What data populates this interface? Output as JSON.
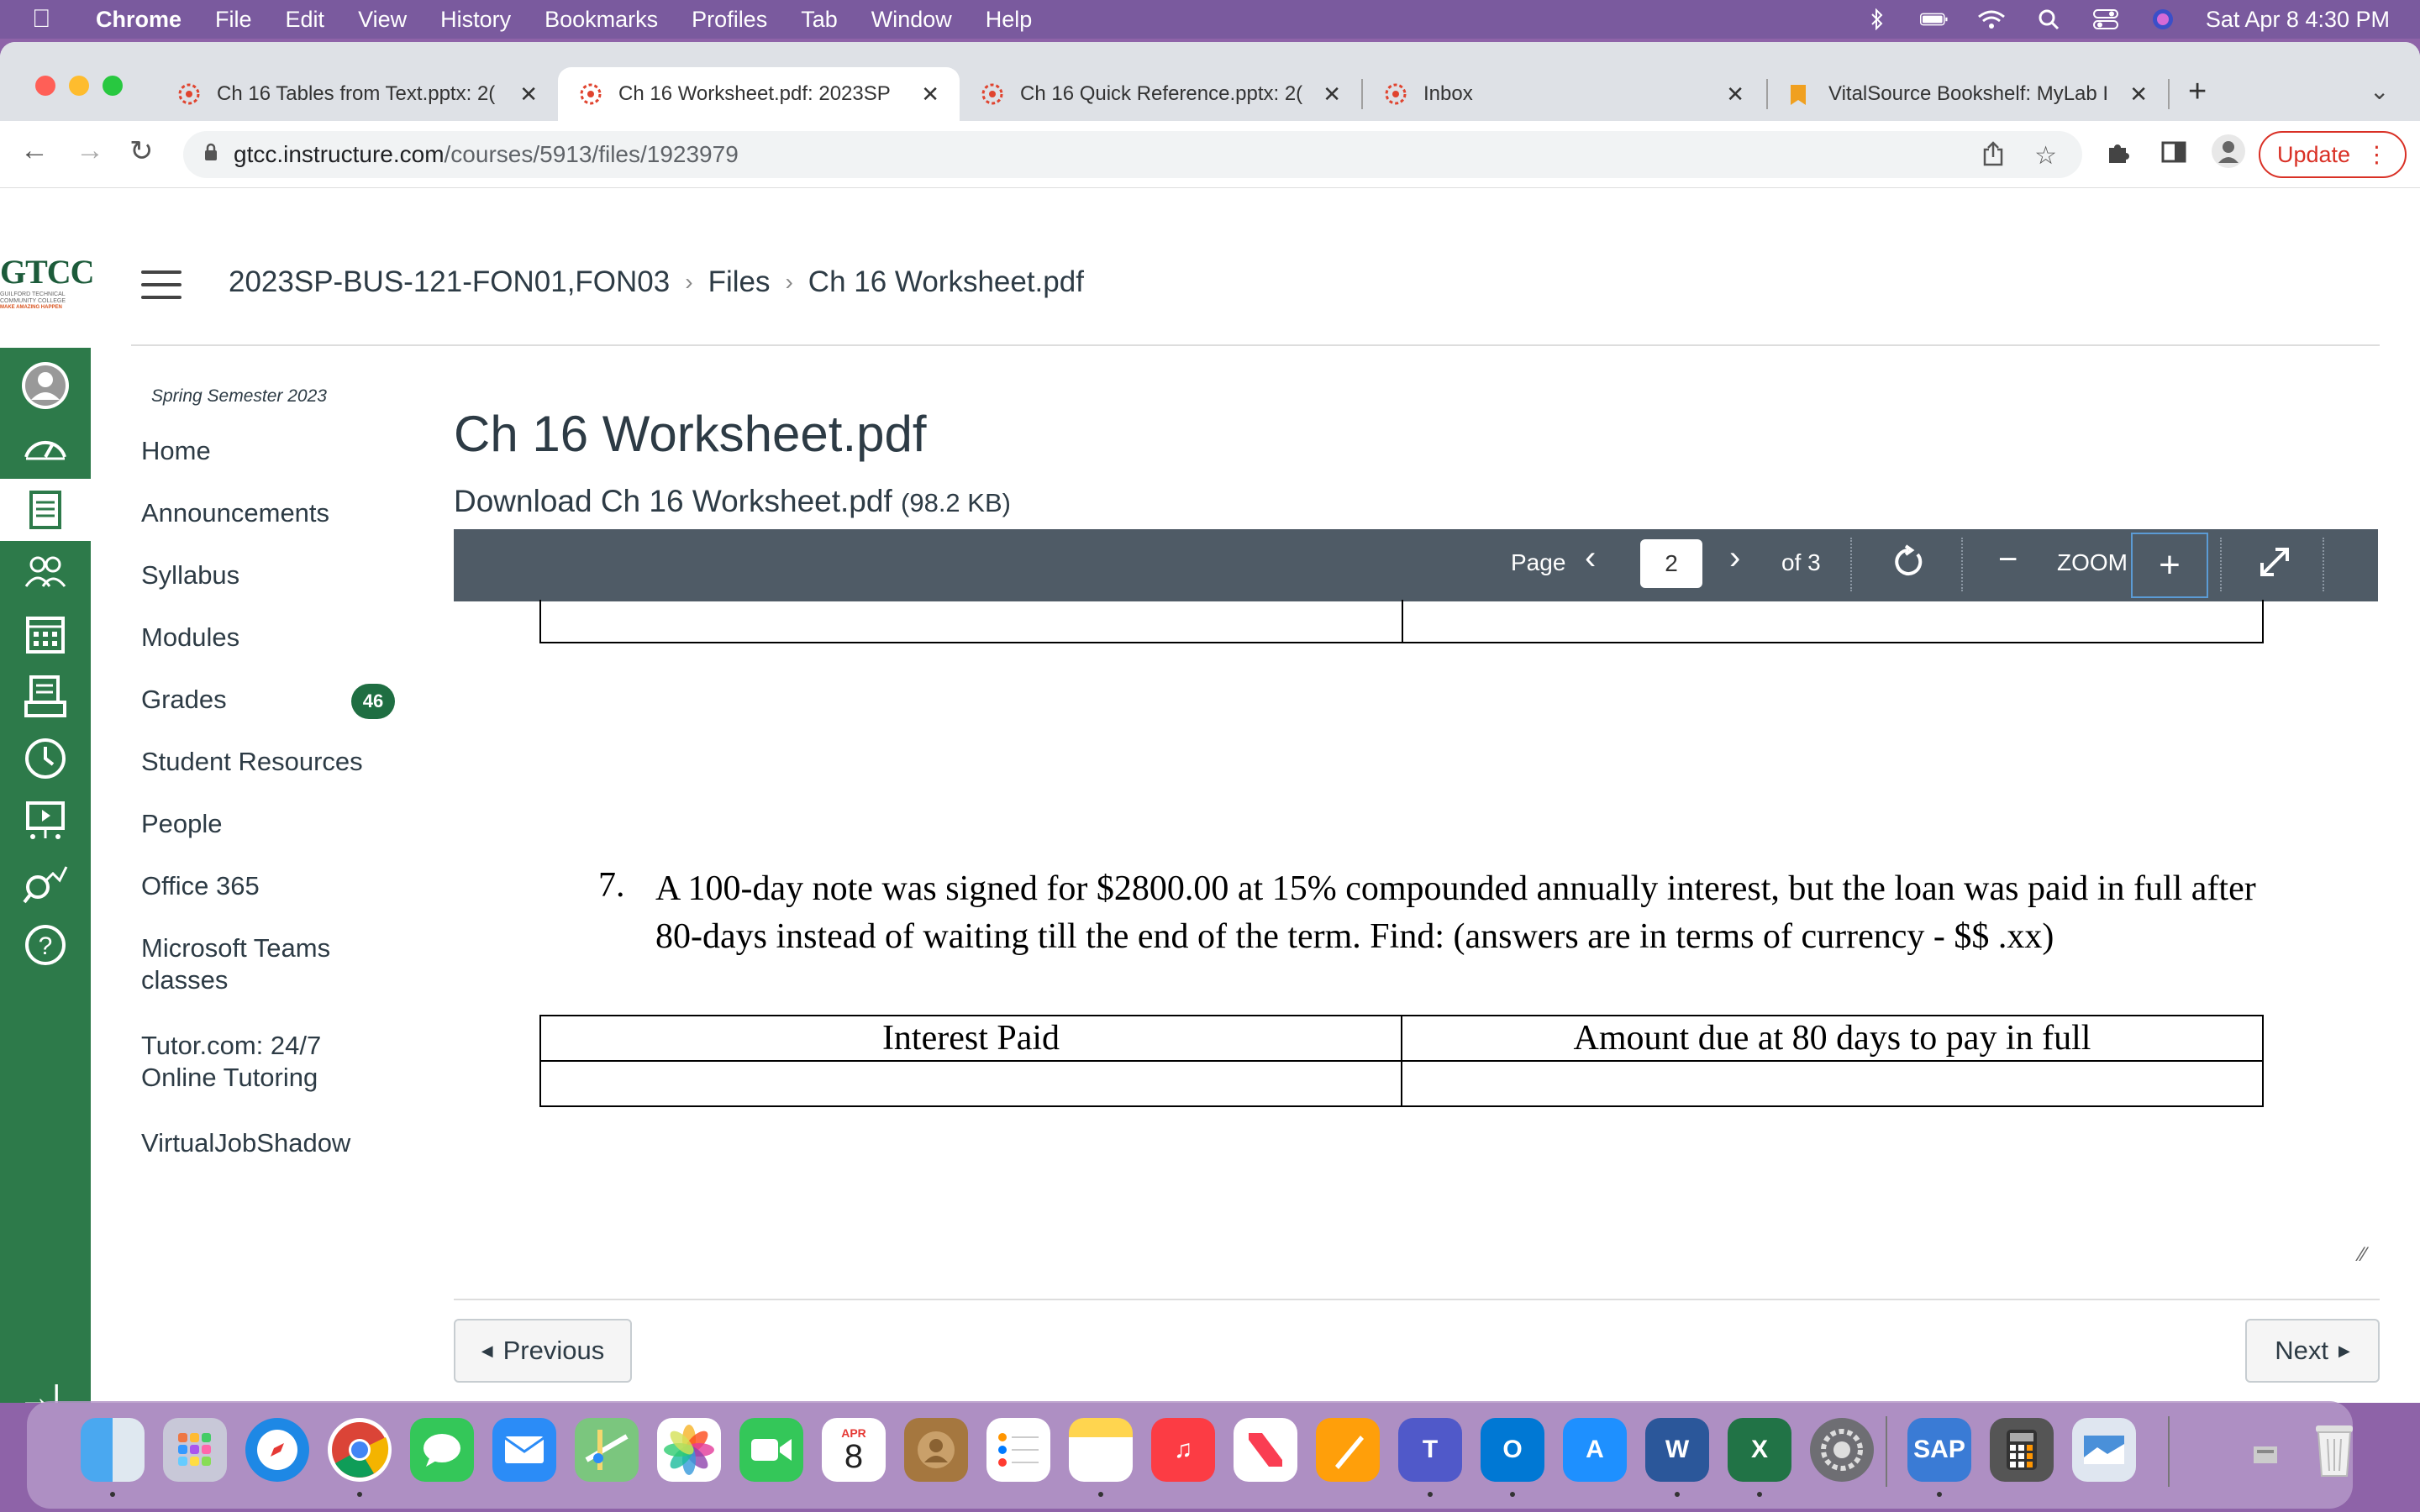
{
  "menubar": {
    "app": "Chrome",
    "items": [
      "File",
      "Edit",
      "View",
      "History",
      "Bookmarks",
      "Profiles",
      "Tab",
      "Window",
      "Help"
    ],
    "datetime": "Sat Apr 8  4:30 PM"
  },
  "tabs": [
    {
      "title": "Ch 16 Tables from Text.pptx: 2(",
      "active": false
    },
    {
      "title": "Ch 16 Worksheet.pdf: 2023SP",
      "active": true
    },
    {
      "title": "Ch 16 Quick Reference.pptx: 2(",
      "active": false
    },
    {
      "title": "Inbox",
      "active": false
    },
    {
      "title": "VitalSource Bookshelf: MyLab I",
      "active": false
    }
  ],
  "omnibox": {
    "host": "gtcc.instructure.com",
    "path": "/courses/5913/files/1923979"
  },
  "toolbar": {
    "update_label": "Update"
  },
  "logo": {
    "text": "GTCC",
    "sub": "GUILFORD TECHNICAL COMMUNITY COLLEGE",
    "tagline": "MAKE AMAZING HAPPEN"
  },
  "breadcrumb": [
    "2023SP-BUS-121-FON01,FON03",
    "Files",
    "Ch 16 Worksheet.pdf"
  ],
  "course_nav": {
    "term": "Spring Semester 2023",
    "items": [
      "Home",
      "Announcements",
      "Syllabus",
      "Modules",
      "Grades",
      "Student Resources",
      "People",
      "Office 365",
      "Microsoft Teams classes",
      "Tutor.com: 24/7 Online Tutoring",
      "VirtualJobShadow"
    ],
    "grades_badge": "46"
  },
  "file": {
    "title": "Ch 16 Worksheet.pdf",
    "download_label": "Download Ch 16 Worksheet.pdf",
    "size": "(98.2 KB)"
  },
  "viewer": {
    "page_label": "Page",
    "current_page": "2",
    "of_label": "of 3",
    "zoom_label": "ZOOM"
  },
  "pdf": {
    "question_number": "7.",
    "question_text": "A 100-day note was signed for $2800.00 at 15% compounded annually interest, but the loan was paid in full after 80-days instead of waiting till the end of the term. Find:  (answers are in terms of currency - $$ .xx)",
    "col1": "Interest Paid",
    "col2": "Amount due at 80 days to pay in full"
  },
  "pager": {
    "previous": "Previous",
    "next": "Next"
  },
  "colors": {
    "canvas_green": "#2d7a4a",
    "viewer_bar": "#4f5b66",
    "menubar": "#7a5a9e"
  }
}
